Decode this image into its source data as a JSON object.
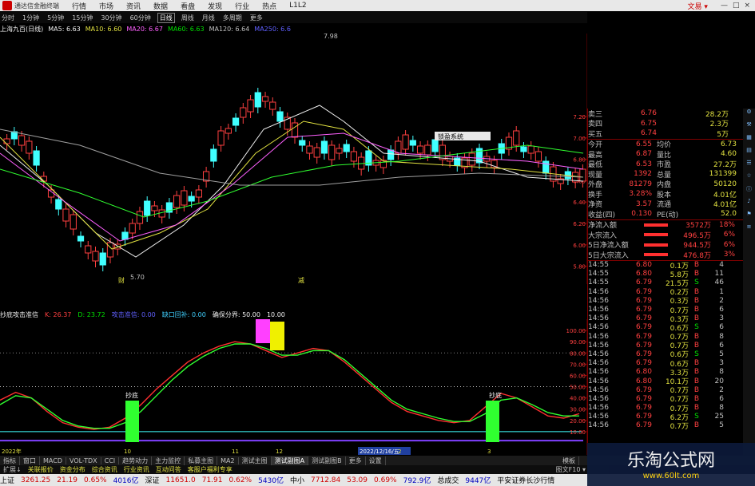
{
  "titlebar": {
    "app_name": "通达信金融终端",
    "menu": [
      "行情",
      "市场",
      "资讯",
      "数据",
      "看盘",
      "发现",
      "行业",
      "热点",
      "L1L2"
    ],
    "brand": "文易 ▾",
    "win_buttons": [
      "—",
      "□",
      "×"
    ]
  },
  "periodbar": {
    "items": [
      "分时",
      "1分钟",
      "5分钟",
      "15分钟",
      "30分钟",
      "60分钟",
      "日线",
      "周线",
      "月线",
      "多周期",
      "更多"
    ],
    "active": "日线"
  },
  "mabar": {
    "stock": "上海九百(日线)",
    "ma5": "MA5: 6.63",
    "ma10": "MA10: 6.60",
    "ma20": "MA20: 6.67",
    "ma60": "MA60: 6.63",
    "ma120": "MA120: 6.64",
    "ma250": "MA250: 6.6"
  },
  "main_chart": {
    "y_ticks": [
      "7.20",
      "7.00",
      "6.80",
      "6.60",
      "6.40",
      "6.20",
      "6.00",
      "5.80"
    ],
    "high_label": "7.98",
    "low_label": "5.70",
    "tip_label": "锁盈系统",
    "marker_a": "财",
    "marker_b": "减"
  },
  "indicator": {
    "name": "抄底攻击准信",
    "k": "K: 26.37",
    "d": "D: 23.72",
    "l1": "攻击准信: 0.00",
    "l2": "缺口回补: 0.00",
    "l3": "确保分界: 50.00",
    "l4": "10.00",
    "y_ticks": [
      "100.00",
      "90.00",
      "80.00",
      "70.00",
      "60.00",
      "50.00",
      "40.00",
      "30.00",
      "20.00",
      "10.00"
    ],
    "signal1": "抄底",
    "signal2": "抄底",
    "x_labels": [
      "2022年",
      "10",
      "11",
      "12",
      "2022/12/16/五",
      "2",
      "3"
    ]
  },
  "chart_data": {
    "type": "line",
    "title": "抄底攻击准信",
    "series": [
      {
        "name": "K",
        "values": [
          38,
          45,
          40,
          28,
          18,
          14,
          12,
          14,
          22,
          34,
          48,
          60,
          72,
          80,
          86,
          90,
          88,
          82,
          76,
          80,
          84,
          82,
          72,
          60,
          48,
          36,
          28,
          24,
          20,
          18,
          20,
          32,
          44,
          40,
          32,
          24,
          22,
          26
        ]
      },
      {
        "name": "D",
        "values": [
          34,
          42,
          40,
          30,
          20,
          15,
          13,
          13,
          18,
          28,
          42,
          56,
          68,
          77,
          84,
          88,
          88,
          84,
          78,
          78,
          82,
          82,
          74,
          62,
          50,
          38,
          30,
          26,
          22,
          19,
          19,
          26,
          38,
          40,
          34,
          27,
          24,
          24
        ]
      }
    ],
    "ylim": [
      0,
      110
    ]
  },
  "quote": {
    "rows": [
      {
        "l": "卖三",
        "v": "6.76",
        "n": "28.2万"
      },
      {
        "l": "卖四",
        "v": "6.75",
        "n": "2.3万"
      },
      {
        "l": "买五",
        "v": "6.74",
        "n": "5万"
      }
    ],
    "stats": [
      [
        "今开",
        "6.55",
        "均价",
        "6.73"
      ],
      [
        "最高",
        "6.87",
        "量比",
        "4.60"
      ],
      [
        "最低",
        "6.53",
        "市盈",
        "27.2万"
      ],
      [
        "现量",
        "1392",
        "总量",
        "131399"
      ],
      [
        "外盘",
        "81279",
        "内盘",
        "50120"
      ],
      [
        "换手",
        "3.28%",
        "股本",
        "4.01亿"
      ],
      [
        "净资",
        "3.57",
        "流通",
        "4.01亿"
      ],
      [
        "收益(四)",
        "0.130",
        "PE(动)",
        "52.0"
      ]
    ],
    "flows": [
      [
        "净流入额",
        "3572万",
        "18%"
      ],
      [
        "大宗流入",
        "496.5万",
        "6%"
      ],
      [
        "5日净流入额",
        "944.5万",
        "6%"
      ],
      [
        "5日大宗流入",
        "476.8万",
        "3%"
      ]
    ]
  },
  "trades": [
    [
      "14:55",
      "6.80",
      "0.1万",
      "B",
      "4"
    ],
    [
      "14:55",
      "6.80",
      "5.8万",
      "B",
      "11"
    ],
    [
      "14:55",
      "6.79",
      "21.5万",
      "S",
      "46"
    ],
    [
      "14:56",
      "6.79",
      "0.2万",
      "B",
      "1"
    ],
    [
      "14:56",
      "6.79",
      "0.3万",
      "B",
      "2"
    ],
    [
      "14:56",
      "6.79",
      "0.7万",
      "B",
      "6"
    ],
    [
      "14:56",
      "6.79",
      "0.3万",
      "B",
      "3"
    ],
    [
      "14:56",
      "6.79",
      "0.6万",
      "S",
      "6"
    ],
    [
      "14:56",
      "6.79",
      "0.7万",
      "B",
      "8"
    ],
    [
      "14:56",
      "6.79",
      "0.7万",
      "B",
      "6"
    ],
    [
      "14:56",
      "6.79",
      "0.6万",
      "S",
      "5"
    ],
    [
      "14:56",
      "6.79",
      "0.6万",
      "B",
      "3"
    ],
    [
      "14:56",
      "6.80",
      "3.3万",
      "B",
      "8"
    ],
    [
      "14:56",
      "6.80",
      "10.1万",
      "B",
      "20"
    ],
    [
      "14:56",
      "6.79",
      "0.7万",
      "B",
      "2"
    ],
    [
      "14:56",
      "6.79",
      "0.7万",
      "B",
      "6"
    ],
    [
      "14:56",
      "6.79",
      "0.7万",
      "B",
      "8"
    ],
    [
      "14:56",
      "6.79",
      "6.2万",
      "S",
      "25"
    ],
    [
      "14:56",
      "6.79",
      "0.7万",
      "B",
      "5"
    ]
  ],
  "tabbar": {
    "items": [
      "指标",
      "窗口",
      "MACD",
      "VOL-TDX",
      "CCI",
      "趋势动力",
      "主力监控",
      "私募主图",
      "MA2",
      "测试主图",
      "测试副图A",
      "测试副图B",
      "更多",
      "设置"
    ],
    "active": "测试副图A",
    "right": "模板"
  },
  "sub_tabs": [
    "扩展↓",
    "关联报价",
    "资金分布",
    "综合资讯",
    "行业资讯",
    "互动问答",
    "客服户福利专享"
  ],
  "sub_right": "图文F10 ▾",
  "statusbar": [
    [
      "上证",
      "3261.25",
      "21.19",
      "0.65%",
      "4016亿"
    ],
    [
      "深证",
      "11651.0",
      "71.91",
      "0.62%",
      "5430亿"
    ],
    [
      "中小",
      "7712.84",
      "53.09",
      "0.69%",
      "792.9亿"
    ],
    [
      "总成交",
      "9447亿"
    ]
  ],
  "status_right": "平安证券长沙行情",
  "watermark": {
    "big": "乐淘公式网",
    "small": "www.60lt.com"
  }
}
